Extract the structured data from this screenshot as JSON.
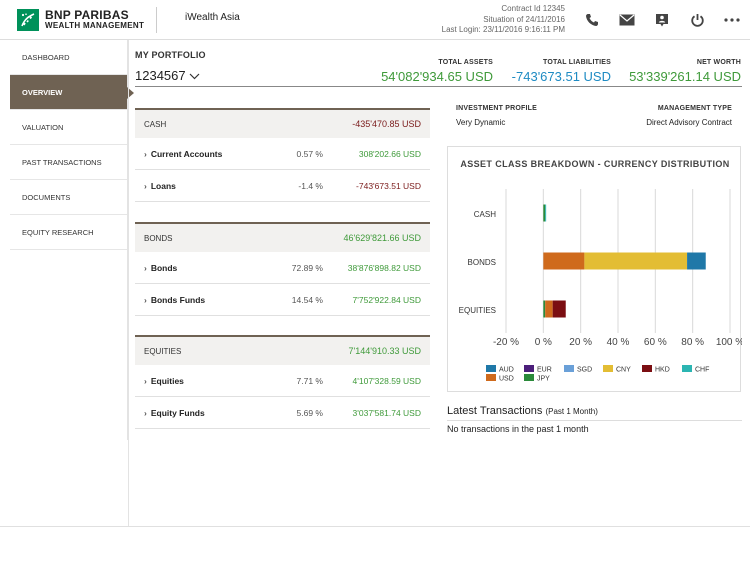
{
  "brand": {
    "line1": "BNP PARIBAS",
    "line2": "WEALTH MANAGEMENT",
    "app_name": "iWealth Asia"
  },
  "contract": {
    "id": "Contract Id 12345",
    "situation": "Situation of 24/11/2016",
    "last_login": "Last Login: 23/11/2016 9:16:11 PM"
  },
  "header_icons": [
    "phone-icon",
    "mail-icon",
    "contact-card-icon",
    "power-icon",
    "more-icon"
  ],
  "sidebar": {
    "items": [
      {
        "label": "DASHBOARD"
      },
      {
        "label": "OVERVIEW"
      },
      {
        "label": "VALUATION"
      },
      {
        "label": "PAST TRANSACTIONS"
      },
      {
        "label": "DOCUMENTS"
      },
      {
        "label": "EQUITY RESEARCH"
      }
    ],
    "active": "OVERVIEW"
  },
  "portfolio": {
    "title": "MY PORTFOLIO",
    "selected": "1234567",
    "total_assets_label": "TOTAL ASSETS",
    "total_assets": "54'082'934.65 USD",
    "total_liabilities_label": "TOTAL LIABILITIES",
    "total_liabilities": "-743'673.51 USD",
    "net_worth_label": "NET WORTH",
    "net_worth": "53'339'261.14 USD"
  },
  "sections": [
    {
      "name": "CASH",
      "amount": "-435'470.85 USD",
      "rows": [
        {
          "name": "Current Accounts",
          "pct": "0.57 %",
          "amount": "308'202.66 USD"
        },
        {
          "name": "Loans",
          "pct": "-1.4 %",
          "amount": "-743'673.51 USD"
        }
      ]
    },
    {
      "name": "BONDS",
      "amount": "46'629'821.66 USD",
      "rows": [
        {
          "name": "Bonds",
          "pct": "72.89 %",
          "amount": "38'876'898.82 USD"
        },
        {
          "name": "Bonds Funds",
          "pct": "14.54 %",
          "amount": "7'752'922.84 USD"
        }
      ]
    },
    {
      "name": "EQUITIES",
      "amount": "7'144'910.33 USD",
      "rows": [
        {
          "name": "Equities",
          "pct": "7.71 %",
          "amount": "4'107'328.59 USD"
        },
        {
          "name": "Equity Funds",
          "pct": "5.69 %",
          "amount": "3'037'581.74 USD"
        }
      ]
    }
  ],
  "profile": {
    "investment_label": "INVESTMENT PROFILE",
    "investment_value": "Very Dynamic",
    "management_label": "MANAGEMENT TYPE",
    "management_value": "Direct Advisory Contract"
  },
  "chart_data": {
    "type": "bar",
    "orientation": "horizontal",
    "stacked": true,
    "title": "ASSET CLASS BREAKDOWN - CURRENCY DISTRIBUTION",
    "categories": [
      "CASH",
      "BONDS",
      "EQUITIES"
    ],
    "xlim": [
      -20,
      100
    ],
    "xticks": [
      "-20 %",
      "0 %",
      "20 %",
      "40 %",
      "60 %",
      "80 %",
      "100 %"
    ],
    "xtick_values": [
      -20,
      0,
      20,
      40,
      60,
      80,
      100
    ],
    "grid": true,
    "legend_position": "bottom",
    "series": [
      {
        "name": "AUD",
        "color": "#1f78a8",
        "values": [
          0,
          10,
          0
        ]
      },
      {
        "name": "EUR",
        "color": "#4b1e7a",
        "values": [
          0,
          0,
          0
        ]
      },
      {
        "name": "SGD",
        "color": "#6aa0d8",
        "values": [
          0,
          0,
          0
        ]
      },
      {
        "name": "CNY",
        "color": "#e3bd34",
        "values": [
          0,
          55,
          0
        ]
      },
      {
        "name": "HKD",
        "color": "#7b0e12",
        "values": [
          0,
          0,
          7
        ]
      },
      {
        "name": "CHF",
        "color": "#2bb5b2",
        "values": [
          0.5,
          0,
          0
        ]
      },
      {
        "name": "USD",
        "color": "#cf6a1c",
        "values": [
          0,
          22,
          4
        ]
      },
      {
        "name": "JPY",
        "color": "#2a8a3a",
        "values": [
          1,
          0,
          1
        ]
      }
    ]
  },
  "latest_transactions": {
    "title": "Latest Transactions",
    "subtitle": "(Past 1 Month)",
    "empty": "No transactions in the past 1 month"
  }
}
